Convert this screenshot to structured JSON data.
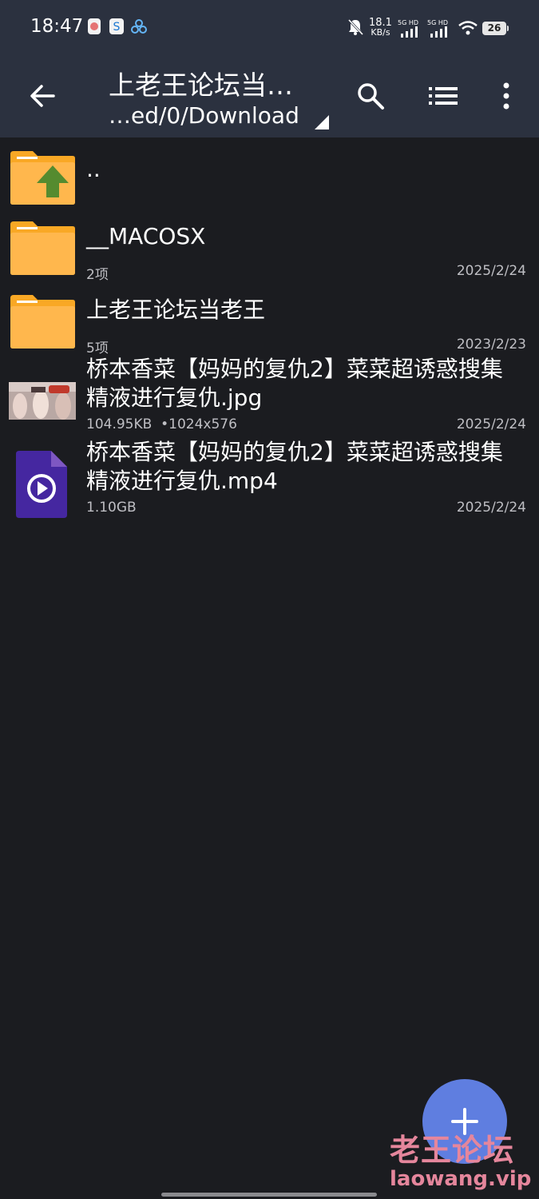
{
  "status_bar": {
    "time": "18:47",
    "speed_value": "18.1",
    "speed_unit": "KB/s",
    "net1": "5G HD",
    "net2": "5G HD",
    "battery": "26"
  },
  "toolbar": {
    "title": "上老王论坛当…",
    "path": "…ed/0/Download",
    "icons": [
      "back-arrow-icon",
      "search-icon",
      "list-view-icon",
      "more-vert-icon"
    ]
  },
  "files": [
    {
      "name": "..",
      "meta": "",
      "date": "",
      "icon": "folder-up-icon"
    },
    {
      "name": "__MACOSX",
      "meta": "2项",
      "date": "2025/2/24",
      "icon": "folder-icon"
    },
    {
      "name": "上老王论坛当老王",
      "meta": "5项",
      "date": "2023/2/23",
      "icon": "folder-icon"
    },
    {
      "name_line1": "桥本香菜【妈妈的复仇2】菜菜超诱惑搜集",
      "name_line2": "精液进行复仇.jpg",
      "meta": "104.95KB  •1024x576",
      "date": "2025/2/24",
      "icon": "image-thumbnail"
    },
    {
      "name_line1": "桥本香菜【妈妈的复仇2】菜菜超诱惑搜集",
      "name_line2": "精液进行复仇.mp4",
      "meta": "1.10GB",
      "date": "2025/2/24",
      "icon": "video-file-icon"
    }
  ],
  "fab": {
    "icon": "plus-icon"
  },
  "watermark": {
    "line1": "老王论坛",
    "line2": "laowang.vip"
  },
  "colors": {
    "toolbar": "#2b313f",
    "background": "#1b1c20",
    "folder": "#f9a825",
    "fab": "#5f7ee0",
    "video": "#4527a0"
  }
}
